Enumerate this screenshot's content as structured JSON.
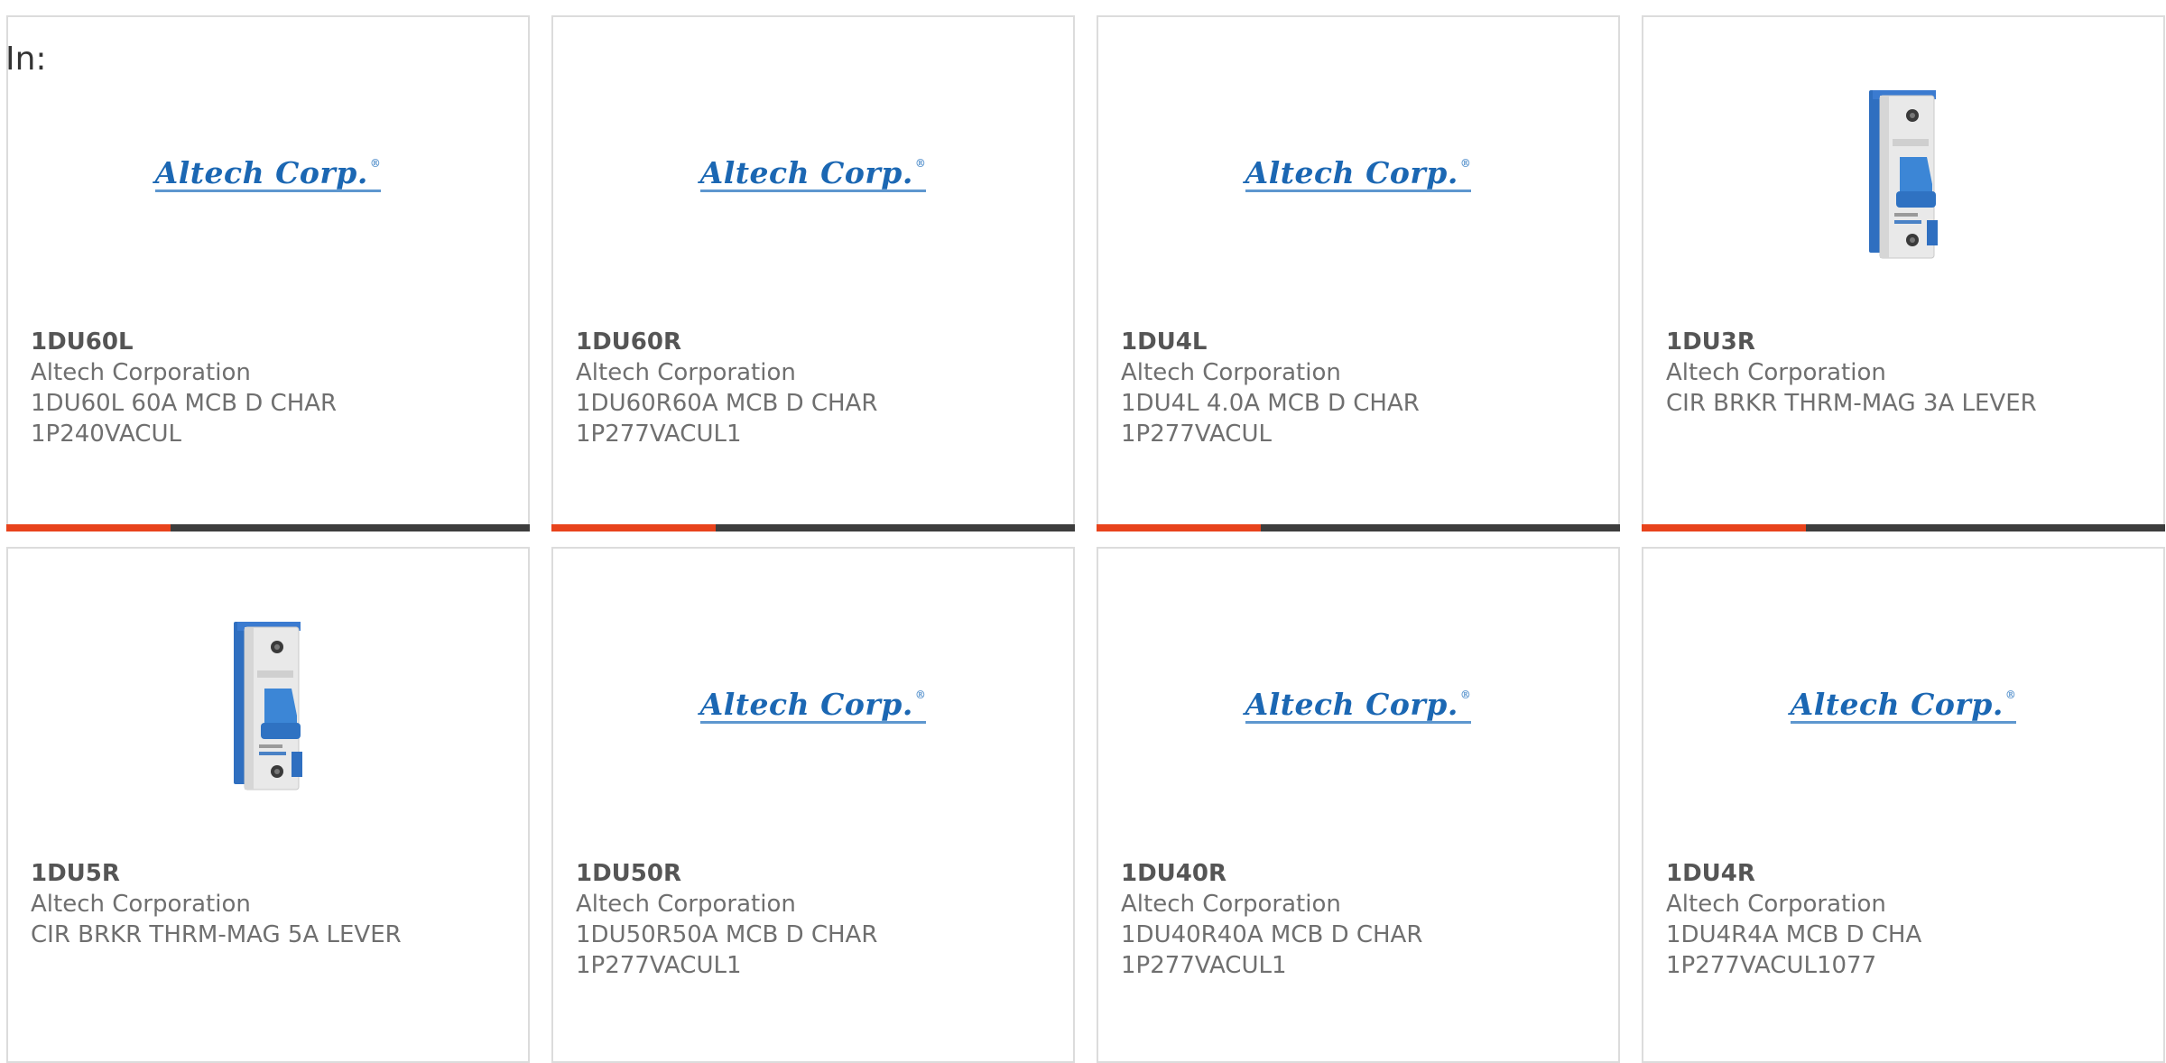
{
  "filter": {
    "label": "In:"
  },
  "brand": {
    "logo_text": "Altech Corp.",
    "logo_mark": "®",
    "logo_color": "#1b67b3",
    "accent_color": "#e8431c",
    "bar_color": "#3d3d3d"
  },
  "products": [
    {
      "part": "1DU60L",
      "manufacturer": "Altech Corporation",
      "description": "1DU60L 60A MCB D CHAR\n1P240VACUL",
      "image": "logo",
      "show_bar": true
    },
    {
      "part": "1DU60R",
      "manufacturer": "Altech Corporation",
      "description": "1DU60R60A MCB D CHAR\n1P277VACUL1",
      "image": "logo",
      "show_bar": true
    },
    {
      "part": "1DU4L",
      "manufacturer": "Altech Corporation",
      "description": "1DU4L 4.0A MCB D CHAR\n1P277VACUL",
      "image": "logo",
      "show_bar": true
    },
    {
      "part": "1DU3R",
      "manufacturer": "Altech Corporation",
      "description": "CIR BRKR THRM-MAG 3A LEVER",
      "image": "breaker",
      "show_bar": true
    },
    {
      "part": "1DU5R",
      "manufacturer": "Altech Corporation",
      "description": "CIR BRKR THRM-MAG 5A LEVER",
      "image": "breaker",
      "show_bar": false
    },
    {
      "part": "1DU50R",
      "manufacturer": "Altech Corporation",
      "description": "1DU50R50A MCB D CHAR\n1P277VACUL1",
      "image": "logo",
      "show_bar": false
    },
    {
      "part": "1DU40R",
      "manufacturer": "Altech Corporation",
      "description": "1DU40R40A MCB D CHAR\n1P277VACUL1",
      "image": "logo",
      "show_bar": false
    },
    {
      "part": "1DU4R",
      "manufacturer": "Altech Corporation",
      "description": "1DU4R4A MCB D CHA\n1P277VACUL1077",
      "image": "logo",
      "show_bar": false
    }
  ]
}
